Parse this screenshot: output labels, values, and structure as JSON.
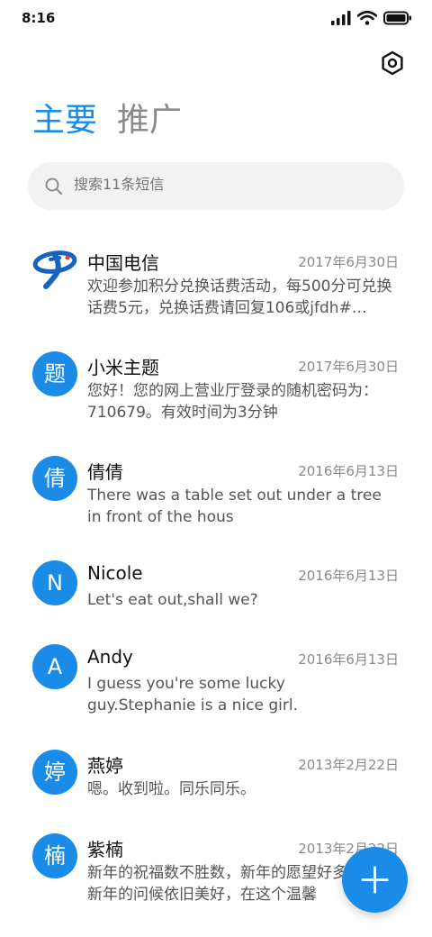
{
  "status_bar": {
    "time": "8:16"
  },
  "tabs": [
    {
      "label": "主要",
      "active": true
    },
    {
      "label": "推广",
      "active": false
    }
  ],
  "search": {
    "placeholder": "搜索11条短信"
  },
  "colors": {
    "accent": "#1a8ce8",
    "muted": "#8a8a8a"
  },
  "conversations": [
    {
      "avatar": "",
      "avatar_icon": "china-telecom-logo-icon",
      "name": "中国电信",
      "date": "2017年6月30日",
      "preview": "欢迎参加积分兑换话费活动，每500分可兑换话费5元，兑换话费请回复106或jfdh#…"
    },
    {
      "avatar": "题",
      "name": "小米主题",
      "date": "2017年6月30日",
      "preview": "您好！您的网上营业厅登录的随机密码为：710679。有效时间为3分钟"
    },
    {
      "avatar": "倩",
      "name": "倩倩",
      "date": "2016年6月13日",
      "preview": "There was a table set out under a tree in front of the hous"
    },
    {
      "avatar": "N",
      "name": "Nicole",
      "date": "2016年6月13日",
      "preview": "Let's eat out,shall we?"
    },
    {
      "avatar": "A",
      "name": "Andy",
      "date": "2016年6月13日",
      "preview": "I guess you're some lucky guy.Stephanie is a nice girl."
    },
    {
      "avatar": "婷",
      "name": "燕婷",
      "date": "2013年2月22日",
      "preview": "嗯。收到啦。同乐同乐。"
    },
    {
      "avatar": "楠",
      "name": "紫楠",
      "date": "2013年2月22日",
      "preview": "新年的祝福数不胜数，新年的愿望好多好多，新年的问候依旧美好，在这个温馨"
    }
  ],
  "fab": {
    "icon": "plus-icon"
  }
}
